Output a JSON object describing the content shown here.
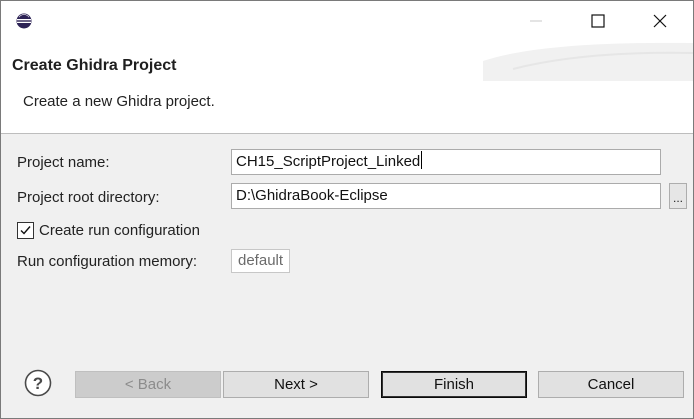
{
  "titlebar": {
    "app_icon": "eclipse-icon",
    "controls": [
      "minimize-icon",
      "maximize-icon",
      "close-icon"
    ]
  },
  "header": {
    "title": "Create Ghidra Project",
    "description": "Create a new Ghidra project."
  },
  "form": {
    "project_name_label": "Project name:",
    "project_name_value": "CH15_ScriptProject_Linked",
    "root_dir_label": "Project root directory:",
    "root_dir_value": "D:\\GhidraBook-Eclipse",
    "browse_label": "...",
    "create_run_config_label": "Create run configuration",
    "create_run_config_checked": true,
    "run_config_memory_label": "Run configuration memory:",
    "run_config_memory_value": "default"
  },
  "footer": {
    "help_icon": "help-icon",
    "back_label": "< Back",
    "next_label": "Next >",
    "finish_label": "Finish",
    "cancel_label": "Cancel"
  }
}
